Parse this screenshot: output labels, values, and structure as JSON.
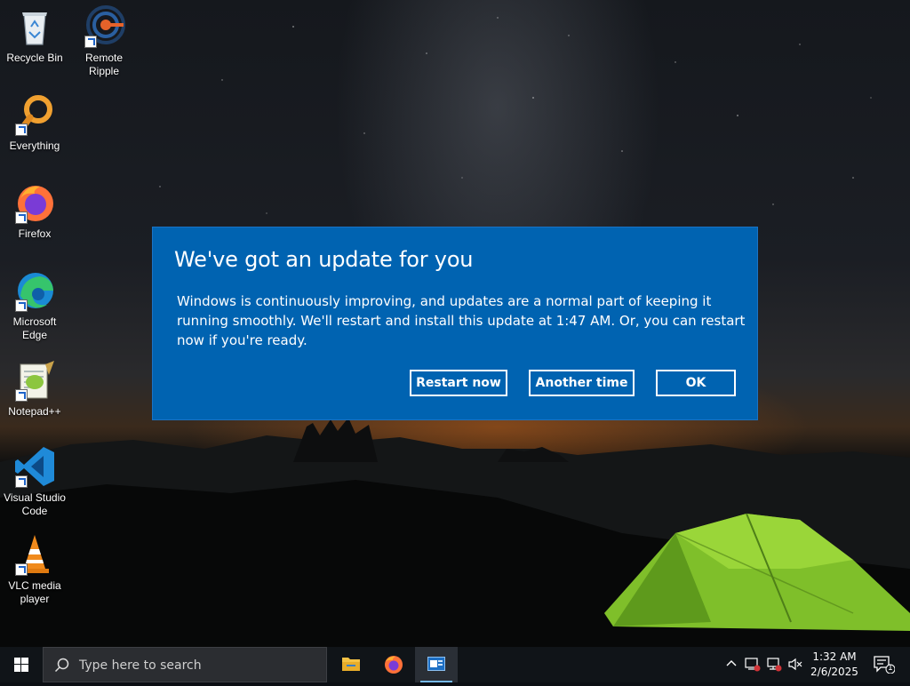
{
  "desktop": {
    "icons": [
      {
        "label": "Recycle Bin"
      },
      {
        "label": "Remote Ripple"
      },
      {
        "label": "Everything"
      },
      {
        "label": "Firefox"
      },
      {
        "label": "Microsoft Edge"
      },
      {
        "label": "Notepad++"
      },
      {
        "label": "Visual Studio Code"
      },
      {
        "label": "VLC media player"
      }
    ]
  },
  "dialog": {
    "title": "We've got an update for you",
    "message": "Windows is continuously improving, and updates are a normal part of keeping it running smoothly. We'll restart and install this update at 1:47 AM. Or, you can restart now if you're ready.",
    "buttons": {
      "restart_now": "Restart now",
      "another_time": "Another time",
      "ok": "OK"
    },
    "background_color": "#0063b1"
  },
  "taskbar": {
    "search_placeholder": "Type here to search",
    "pinned_apps": [
      "File Explorer",
      "Firefox",
      "Active window"
    ],
    "clock": {
      "time": "1:32 AM",
      "date": "2/6/2025"
    },
    "notification_count": "1"
  }
}
